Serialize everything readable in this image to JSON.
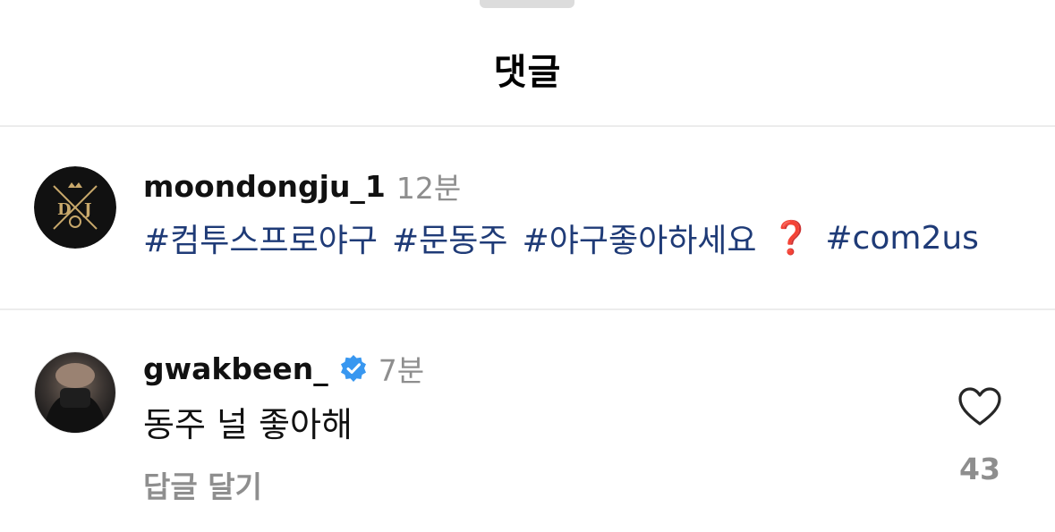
{
  "header": {
    "title": "댓글"
  },
  "comments": [
    {
      "username": "moondongju_1",
      "time": "12분",
      "tags": [
        "#컴투스프로야구",
        "#문동주",
        "#야구좋아하세요",
        "#com2us"
      ],
      "emoji": "❓",
      "verified": false
    },
    {
      "username": "gwakbeen_",
      "time": "7분",
      "text": "동주 널 좋아해",
      "reply_label": "답글 달기",
      "likes": "43",
      "verified": true
    }
  ],
  "colors": {
    "hashtag": "#1f3b77",
    "secondary": "#8e8e8e",
    "verified": "#3897f0"
  }
}
